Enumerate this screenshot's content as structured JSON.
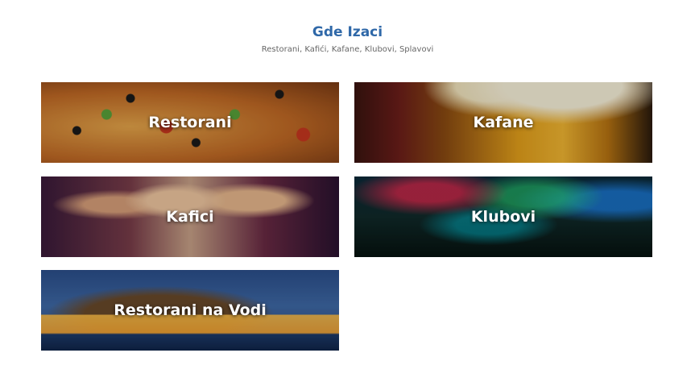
{
  "section": {
    "title": "Gde Izaci",
    "subtitle": "Restorani, Kafići, Kafane, Klubovi, Splavovi"
  },
  "categories": [
    {
      "label": "Restorani",
      "image": "pizza-photo"
    },
    {
      "label": "Kafane",
      "image": "beer-photo"
    },
    {
      "label": "Kafici",
      "image": "friends-toasting-photo"
    },
    {
      "label": "Klubovi",
      "image": "nightclub-photo"
    },
    {
      "label": "Restorani na Vodi",
      "image": "waterfront-restaurant-photo"
    }
  ]
}
